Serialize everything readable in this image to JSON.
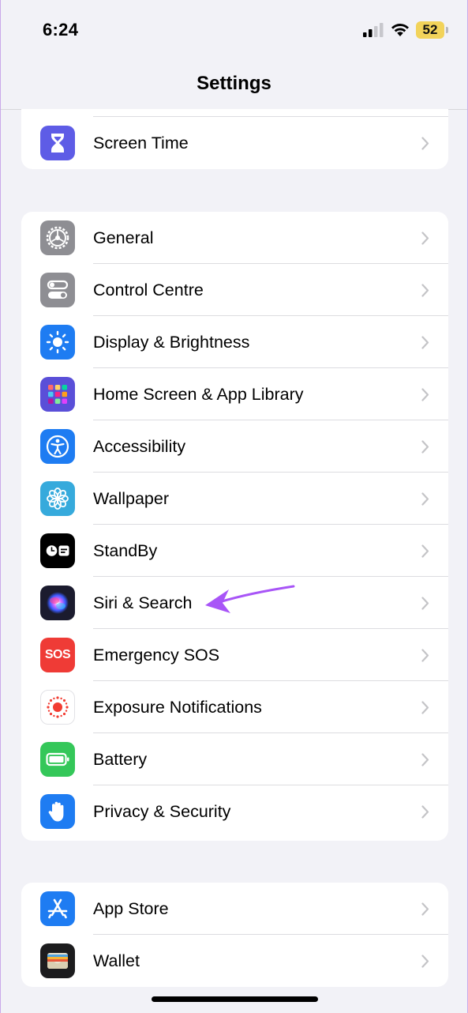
{
  "status_bar": {
    "time": "6:24",
    "battery_level": "52"
  },
  "nav": {
    "title": "Settings"
  },
  "groups": [
    {
      "items": [
        {
          "label": "Screen Time",
          "icon": "hourglass-icon",
          "color": "#5e5ce6"
        }
      ]
    },
    {
      "items": [
        {
          "label": "General",
          "icon": "gear-icon",
          "color": "#8e8e93"
        },
        {
          "label": "Control Centre",
          "icon": "toggles-icon",
          "color": "#8e8e93"
        },
        {
          "label": "Display & Brightness",
          "icon": "sun-icon",
          "color": "#1e7cf2"
        },
        {
          "label": "Home Screen & App Library",
          "icon": "app-grid-icon",
          "color": "#5a4fd8"
        },
        {
          "label": "Accessibility",
          "icon": "accessibility-icon",
          "color": "#1e7cf2"
        },
        {
          "label": "Wallpaper",
          "icon": "flower-icon",
          "color": "#36aadc"
        },
        {
          "label": "StandBy",
          "icon": "standby-icon",
          "color": "#000000"
        },
        {
          "label": "Siri & Search",
          "icon": "siri-icon",
          "color": "#1b1b2e"
        },
        {
          "label": "Emergency SOS",
          "icon": "sos-icon",
          "color": "#ef3b36"
        },
        {
          "label": "Exposure Notifications",
          "icon": "exposure-icon",
          "color": "#ffffff"
        },
        {
          "label": "Battery",
          "icon": "battery-icon",
          "color": "#34c759"
        },
        {
          "label": "Privacy & Security",
          "icon": "hand-icon",
          "color": "#1e7cf2"
        }
      ]
    },
    {
      "items": [
        {
          "label": "App Store",
          "icon": "app-store-icon",
          "color": "#1e7cf2"
        },
        {
          "label": "Wallet",
          "icon": "wallet-icon",
          "color": "#1c1c1e"
        }
      ]
    }
  ],
  "sos_text": "SOS",
  "annotation": {
    "arrow_color": "#a855f7"
  }
}
